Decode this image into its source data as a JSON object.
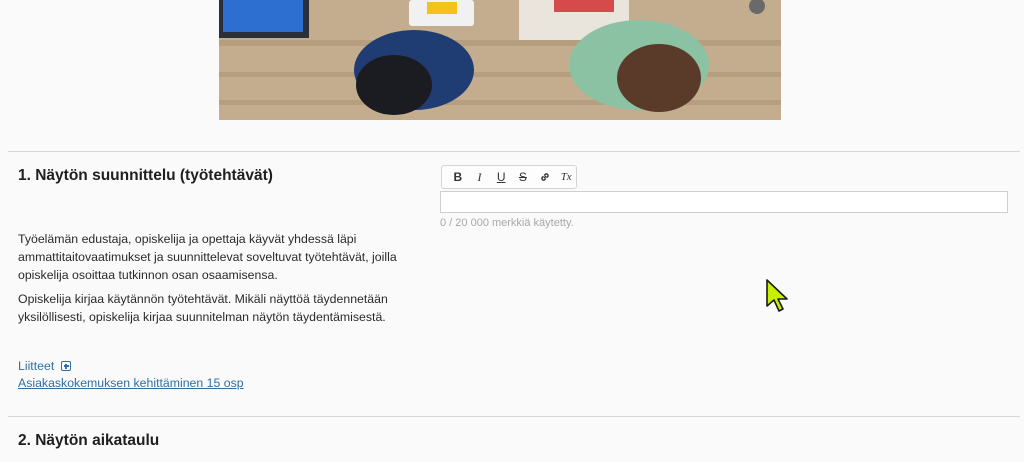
{
  "section1": {
    "title": "1. Näytön suunnittelu (työtehtävät)",
    "description": [
      "Työelämän edustaja, opiskelija ja opettaja käyvät yhdessä läpi ammattitaitovaatimukset ja suunnittelevat soveltuvat työtehtävät, joilla opiskelija osoittaa tutkinnon osan osaamisensa.",
      "Opiskelija kirjaa käytännön työtehtävät. Mikäli näyttöä täydennetään yksilöllisesti, opiskelija kirjaa suunnitelman näytön täydentämisestä."
    ],
    "attachments_label": "Liitteet",
    "attachment_link": "Asiakaskokemuksen kehittäminen 15 osp",
    "editor": {
      "toolbar": [
        {
          "label": "B",
          "icon": "bold-icon"
        },
        {
          "label": "I",
          "icon": "italic-icon"
        },
        {
          "label": "U",
          "icon": "underline-icon"
        },
        {
          "label": "S",
          "icon": "strikethrough-icon"
        },
        {
          "label": "",
          "icon": "link-icon"
        },
        {
          "label": "Tx",
          "icon": "clear-format-icon"
        }
      ],
      "value": "",
      "counter": "0 / 20 000 merkkiä käytetty."
    }
  },
  "section2": {
    "title": "2. Näytön aikataulu"
  },
  "colors": {
    "link": "#2e6fa6",
    "cursor": "#c6f000",
    "divider": "#d6d6d6"
  }
}
